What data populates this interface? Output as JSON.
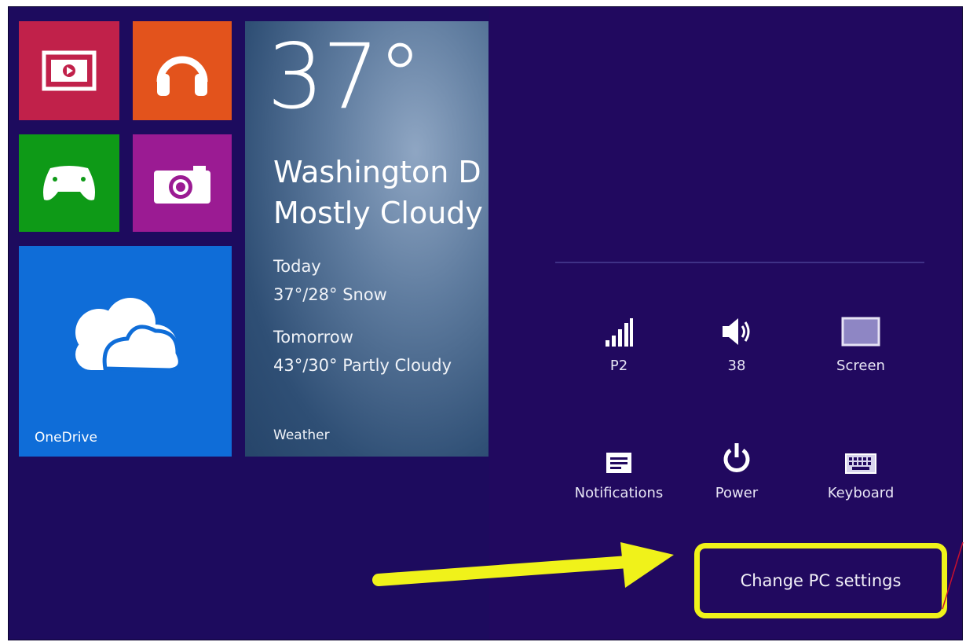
{
  "tiles": {
    "video": {
      "icon": "video-icon",
      "color": "#c1214a"
    },
    "music": {
      "icon": "headphones-icon",
      "color": "#e3531c"
    },
    "games": {
      "icon": "game-controller-icon",
      "color": "#0e9a17"
    },
    "camera": {
      "icon": "camera-icon",
      "color": "#9b1b93"
    },
    "onedrive": {
      "label": "OneDrive",
      "icon": "cloud-icon",
      "color": "#0f6dd8"
    },
    "weather": {
      "temperature": "37°",
      "city": "Washington D",
      "condition": "Mostly Cloudy",
      "today_label": "Today",
      "today_forecast": "37°/28° Snow",
      "tomorrow_label": "Tomorrow",
      "tomorrow_forecast": "43°/30° Partly Cloudy",
      "label": "Weather"
    }
  },
  "settings": {
    "quick": [
      {
        "label": "P2",
        "icon": "network-signal-icon"
      },
      {
        "label": "38",
        "icon": "volume-icon"
      },
      {
        "label": "Screen",
        "icon": "screen-brightness-icon"
      },
      {
        "label": "Notifications",
        "icon": "notifications-icon"
      },
      {
        "label": "Power",
        "icon": "power-icon"
      },
      {
        "label": "Keyboard",
        "icon": "keyboard-icon"
      }
    ],
    "change_pc_settings": "Change PC settings"
  },
  "colors": {
    "background": "#1d0b5e",
    "settings_pane": "#21095f",
    "highlight": "#f0f21a"
  }
}
